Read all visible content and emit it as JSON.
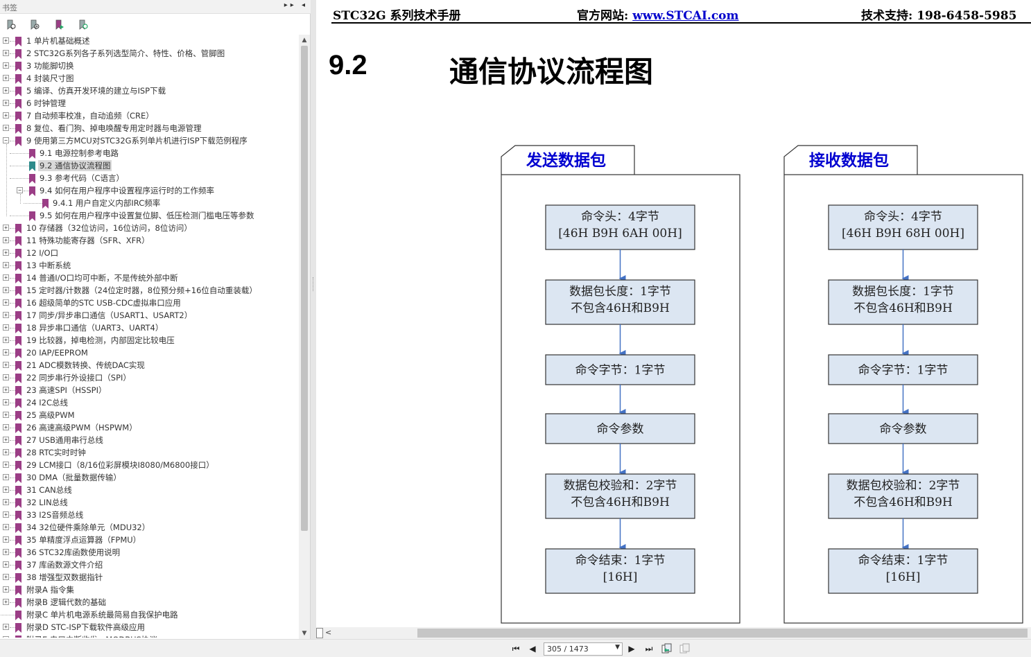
{
  "bookmarks_pane": {
    "title": "书签",
    "header_buttons": "▸▸ ◂",
    "toolbar_icons": [
      "bookmark-options-icon",
      "expand-bookmark-icon",
      "go-to-bookmark-icon",
      "find-bookmark-icon"
    ],
    "items": [
      {
        "label": "1 单片机基础概述",
        "level": 0,
        "expander": "+"
      },
      {
        "label": "2 STC32G系列各子系列选型简介、特性、价格、管脚图",
        "level": 0,
        "expander": "+"
      },
      {
        "label": "3 功能脚切换",
        "level": 0,
        "expander": "+"
      },
      {
        "label": "4 封装尺寸图",
        "level": 0,
        "expander": "+"
      },
      {
        "label": "5 编译、仿真开发环境的建立与ISP下载",
        "level": 0,
        "expander": "+"
      },
      {
        "label": "6 时钟管理",
        "level": 0,
        "expander": "+"
      },
      {
        "label": "7 自动频率校准，自动追频（CRE）",
        "level": 0,
        "expander": "+"
      },
      {
        "label": "8 复位、看门狗、掉电唤醒专用定时器与电源管理",
        "level": 0,
        "expander": "+"
      },
      {
        "label": "9 使用第三方MCU对STC32G系列单片机进行ISP下载范例程序",
        "level": 0,
        "expander": "-"
      },
      {
        "label": "9.1 电源控制参考电路",
        "level": 1,
        "expander": ""
      },
      {
        "label": "9.2 通信协议流程图",
        "level": 1,
        "expander": "",
        "selected": true
      },
      {
        "label": "9.3 参考代码（C语言）",
        "level": 1,
        "expander": ""
      },
      {
        "label": "9.4 如何在用户程序中设置程序运行时的工作频率",
        "level": 1,
        "expander": "-"
      },
      {
        "label": "9.4.1 用户自定义内部IRC频率",
        "level": 2,
        "expander": ""
      },
      {
        "label": "9.5 如何在用户程序中设置复位脚、低压检测门槛电压等参数",
        "level": 1,
        "expander": ""
      },
      {
        "label": "10 存储器（32位访问，16位访问，8位访问）",
        "level": 0,
        "expander": "+"
      },
      {
        "label": "11 特殊功能寄存器（SFR、XFR）",
        "level": 0,
        "expander": "+"
      },
      {
        "label": "12 I/O口",
        "level": 0,
        "expander": "+"
      },
      {
        "label": "13 中断系统",
        "level": 0,
        "expander": "+"
      },
      {
        "label": "14 普通I/O口均可中断，不是传统外部中断",
        "level": 0,
        "expander": "+"
      },
      {
        "label": "15 定时器/计数器（24位定时器，8位预分频+16位自动重装载）",
        "level": 0,
        "expander": "+"
      },
      {
        "label": "16 超级简单的STC USB-CDC虚拟串口应用",
        "level": 0,
        "expander": "+"
      },
      {
        "label": "17 同步/异步串口通信（USART1、USART2）",
        "level": 0,
        "expander": "+"
      },
      {
        "label": "18 异步串口通信（UART3、UART4）",
        "level": 0,
        "expander": "+"
      },
      {
        "label": "19 比较器，掉电检测，内部固定比较电压",
        "level": 0,
        "expander": "+"
      },
      {
        "label": "20 IAP/EEPROM",
        "level": 0,
        "expander": "+"
      },
      {
        "label": "21 ADC模数转换、传统DAC实现",
        "level": 0,
        "expander": "+"
      },
      {
        "label": "22 同步串行外设接口（SPI）",
        "level": 0,
        "expander": "+"
      },
      {
        "label": "23 高速SPI（HSSPI）",
        "level": 0,
        "expander": "+"
      },
      {
        "label": "24 I2C总线",
        "level": 0,
        "expander": "+"
      },
      {
        "label": "25 高级PWM",
        "level": 0,
        "expander": "+"
      },
      {
        "label": "26 高速高级PWM（HSPWM）",
        "level": 0,
        "expander": "+"
      },
      {
        "label": "27 USB通用串行总线",
        "level": 0,
        "expander": "+"
      },
      {
        "label": "28 RTC实时时钟",
        "level": 0,
        "expander": "+"
      },
      {
        "label": "29 LCM接口（8/16位彩屏模块I8080/M6800接口）",
        "level": 0,
        "expander": "+"
      },
      {
        "label": "30 DMA（批量数据传输）",
        "level": 0,
        "expander": "+"
      },
      {
        "label": "31 CAN总线",
        "level": 0,
        "expander": "+"
      },
      {
        "label": "32 LIN总线",
        "level": 0,
        "expander": "+"
      },
      {
        "label": "33 I2S音频总线",
        "level": 0,
        "expander": "+"
      },
      {
        "label": "34 32位硬件乘除单元（MDU32）",
        "level": 0,
        "expander": "+"
      },
      {
        "label": "35 单精度浮点运算器（FPMU）",
        "level": 0,
        "expander": "+"
      },
      {
        "label": "36 STC32库函数使用说明",
        "level": 0,
        "expander": "+"
      },
      {
        "label": "37 库函数源文件介绍",
        "level": 0,
        "expander": "+"
      },
      {
        "label": "38 增强型双数据指针",
        "level": 0,
        "expander": "+"
      },
      {
        "label": "附录A 指令集",
        "level": 0,
        "expander": "+"
      },
      {
        "label": "附录B 逻辑代数的基础",
        "level": 0,
        "expander": "+"
      },
      {
        "label": "附录C 单片机电源系统最简易自我保护电路",
        "level": 0,
        "expander": ""
      },
      {
        "label": "附录D STC-ISP下载软件高级应用",
        "level": 0,
        "expander": "+"
      },
      {
        "label": "附录E 串口中断收发—MODBUS协议",
        "level": 0,
        "expander": "+"
      }
    ]
  },
  "document": {
    "header": {
      "left": "STC32G 系列技术手册",
      "mid_label": "官方网站: ",
      "mid_link": "www.STCAI.com",
      "right": "技术支持: 198-6458-5985"
    },
    "section_number": "9.2",
    "section_title": "通信协议流程图",
    "send_flow": {
      "title": "发送数据包",
      "boxes": [
        [
          "命令头：4字节",
          "[46H B9H 6AH 00H]"
        ],
        [
          "数据包长度：1字节",
          "不包含46H和B9H"
        ],
        [
          "命令字节：1字节"
        ],
        [
          "命令参数"
        ],
        [
          "数据包校验和：2字节",
          "不包含46H和B9H"
        ],
        [
          "命令结束：1字节",
          "[16H]"
        ]
      ]
    },
    "receive_flow": {
      "title": "接收数据包",
      "boxes": [
        [
          "命令头：4字节",
          "[46H B9H 68H 00H]"
        ],
        [
          "数据包长度：1字节",
          "不包含46H和B9H"
        ],
        [
          "命令字节：1字节"
        ],
        [
          "命令参数"
        ],
        [
          "数据包校验和：2字节",
          "不包含46H和B9H"
        ],
        [
          "命令结束：1字节",
          "[16H]"
        ]
      ]
    },
    "colors": {
      "box_fill": "#dce6f2",
      "arrow": "#4472c4",
      "tab_text": "#0000d0",
      "link": "#0000cc",
      "bookmark_flag": "#9b3e86",
      "bookmark_flag_selected": "#2e8b8b"
    }
  },
  "navbar": {
    "page_display": "305 / 1473",
    "buttons": [
      "first-page-icon",
      "previous-page-icon",
      "next-page-icon",
      "last-page-icon",
      "previous-view-icon",
      "next-view-icon"
    ]
  }
}
